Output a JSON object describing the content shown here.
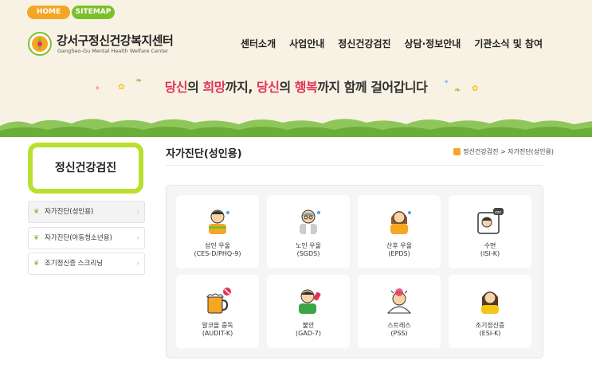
{
  "top_links": {
    "home": "HOME",
    "sitemap": "SITEMAP"
  },
  "org": {
    "name": "강서구정신건강복지센터",
    "sub": "GangSeo-Gu Mental Health Welfare Center"
  },
  "gnb": [
    "센터소개",
    "사업안내",
    "정신건강검진",
    "상담·정보안내",
    "기관소식 및 참여"
  ],
  "slogan": {
    "p1": "당신",
    "p2": "의 ",
    "p3": "희망",
    "p4": "까지, ",
    "p5": "당신",
    "p6": "의 ",
    "p7": "행복",
    "p8": "까지 함께 걸어갑니다"
  },
  "lnb": {
    "title": "정신건강검진",
    "items": [
      "자가진단(성인용)",
      "자가진단(아동청소년용)",
      "조기정신증 스크리닝"
    ]
  },
  "page": {
    "title": "자가진단(성인용)",
    "crumb": "정신건강검진 > 자가진단(성인용)"
  },
  "cards": [
    {
      "l1": "성인 우울",
      "l2": "(CES-D/PHQ-9)",
      "icon": "adult-depression-icon"
    },
    {
      "l1": "노인 우울",
      "l2": "(SGDS)",
      "icon": "elderly-depression-icon"
    },
    {
      "l1": "산후 우울",
      "l2": "(EPDS)",
      "icon": "postpartum-depression-icon"
    },
    {
      "l1": "수면",
      "l2": "(ISI-K)",
      "icon": "sleep-icon"
    },
    {
      "l1": "알코올 중독",
      "l2": "(AUDIT-K)",
      "icon": "alcohol-icon"
    },
    {
      "l1": "불안",
      "l2": "(GAD-7)",
      "icon": "anxiety-icon"
    },
    {
      "l1": "스트레스",
      "l2": "(PSS)",
      "icon": "stress-icon"
    },
    {
      "l1": "조기정신증",
      "l2": "(ESI-K)",
      "icon": "early-psychosis-icon"
    }
  ],
  "colors": {
    "accent_green": "#b9e02e",
    "accent_orange": "#f5a623",
    "accent_pink": "#e2335b",
    "band": "#f7f2e3"
  }
}
